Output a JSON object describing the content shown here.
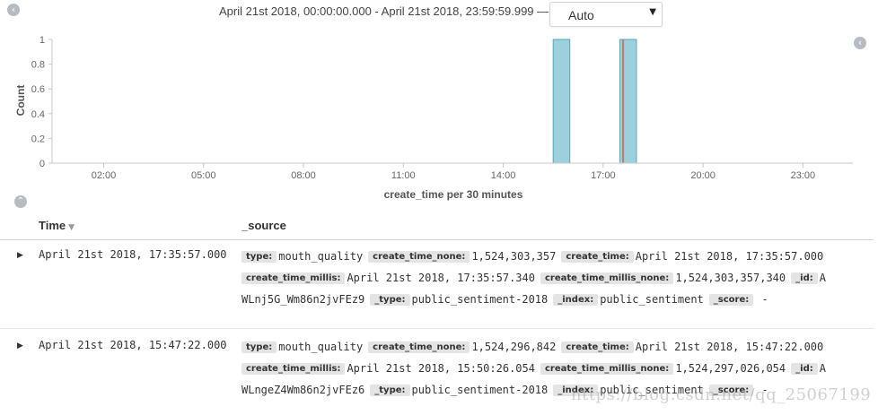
{
  "time_range": {
    "label": "April 21st 2018, 00:00:00.000 - April 21st 2018, 23:59:59.999 —",
    "interval": "Auto"
  },
  "chart_data": {
    "type": "bar",
    "ylabel": "Count",
    "xlabel": "create_time per 30 minutes",
    "ylim": [
      0,
      1
    ],
    "y_ticks": [
      "0",
      "0.2",
      "0.4",
      "0.6",
      "0.8",
      "1"
    ],
    "x_ticks": [
      "02:00",
      "05:00",
      "08:00",
      "11:00",
      "14:00",
      "17:00",
      "20:00",
      "23:00"
    ],
    "x_range": [
      "00:27",
      "24:30"
    ],
    "bars": [
      {
        "start": "15:30",
        "end": "16:00",
        "count": 1
      },
      {
        "start": "17:30",
        "end": "18:00",
        "count": 1
      }
    ],
    "marker": {
      "time": "17:36"
    },
    "bar_color": "#9bd0dc",
    "bar_border": "#5ba7b8",
    "marker_color": "#c27c63"
  },
  "table": {
    "col_time": "Time",
    "col_source": "_source",
    "rows": [
      {
        "time": "April 21st 2018, 17:35:57.000",
        "lines": [
          [
            [
              "type:",
              "mouth_quality"
            ],
            [
              "create_time_none:",
              "1,524,303,357"
            ],
            [
              "create_time:",
              "April 21st 2018, 17:35:57.000"
            ]
          ],
          [
            [
              "create_time_millis:",
              "April 21st 2018, 17:35:57.340"
            ],
            [
              "create_time_millis_none:",
              "1,524,303,357,340"
            ],
            [
              "_id:",
              "A"
            ]
          ],
          [
            [
              "",
              "WLnj5G_Wm86n2jvFEz9"
            ],
            [
              "_type:",
              "public_sentiment-2018"
            ],
            [
              "_index:",
              "public_sentiment"
            ],
            [
              "_score:",
              " -"
            ]
          ]
        ]
      },
      {
        "time": "April 21st 2018, 15:47:22.000",
        "lines": [
          [
            [
              "type:",
              "mouth_quality"
            ],
            [
              "create_time_none:",
              "1,524,296,842"
            ],
            [
              "create_time:",
              "April 21st 2018, 15:47:22.000"
            ]
          ],
          [
            [
              "create_time_millis:",
              "April 21st 2018, 15:50:26.054"
            ],
            [
              "create_time_millis_none:",
              "1,524,297,026,054"
            ],
            [
              "_id:",
              "A"
            ]
          ],
          [
            [
              "",
              "WLngeZ4Wm86n2jvFEz6"
            ],
            [
              "_type:",
              "public_sentiment-2018"
            ],
            [
              "_index:",
              "public_sentiment"
            ],
            [
              "_score:",
              " -"
            ]
          ]
        ]
      }
    ]
  },
  "watermark": "https://blog.csdn.net/qq_25067199"
}
